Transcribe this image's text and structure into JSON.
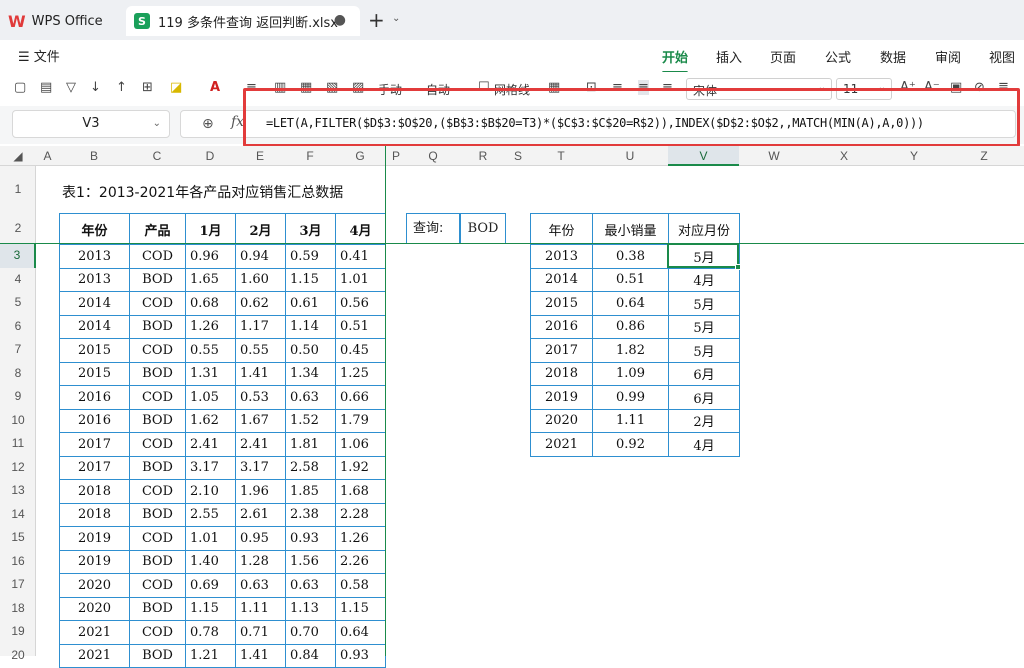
{
  "window": {
    "app_tab": "WPS Office",
    "file_tab": "119 多条件查询 返回判断.xlsx",
    "file_icon_letter": "S",
    "modified_dot": "●",
    "new_tab_glyph": "+",
    "new_tab_caret": "⌄"
  },
  "menubar": {
    "file_menu": "☰ 文件",
    "tabs": [
      "开始",
      "插入",
      "页面",
      "公式",
      "数据",
      "审阅",
      "视图"
    ],
    "active_tab": "开始"
  },
  "toolbar": {
    "manual": "手动",
    "auto": "自动",
    "gridlines": "网格线",
    "font_name": "宋体",
    "font_size": "11"
  },
  "formula_bar": {
    "name_box": "V3",
    "fx": "fx",
    "formula": "=LET(A,FILTER($D$3:$O$20,($B$3:$B$20=T3)*($C$3:$C$20=R$2)),INDEX($D$2:$O$2,,MATCH(MIN(A),A,0)))"
  },
  "columns": [
    "A",
    "B",
    "C",
    "D",
    "E",
    "F",
    "G",
    "P",
    "Q",
    "R",
    "S",
    "T",
    "U",
    "V",
    "W",
    "X",
    "Y",
    "Z"
  ],
  "selected_column": "V",
  "rows": [
    "1",
    "2",
    "3",
    "4",
    "5",
    "6",
    "7",
    "8",
    "9",
    "10",
    "11",
    "12",
    "13",
    "14",
    "15",
    "16",
    "17",
    "18",
    "19",
    "20"
  ],
  "selected_row": "3",
  "sheet": {
    "title": "表1：2013-2021年各产品对应销售汇总数据",
    "main_table": {
      "headers": [
        "年份",
        "产品",
        "1月",
        "2月",
        "3月",
        "4月"
      ],
      "rows": [
        [
          "2013",
          "COD",
          "0.96",
          "0.94",
          "0.59",
          "0.41"
        ],
        [
          "2013",
          "BOD",
          "1.65",
          "1.60",
          "1.15",
          "1.01"
        ],
        [
          "2014",
          "COD",
          "0.68",
          "0.62",
          "0.61",
          "0.56"
        ],
        [
          "2014",
          "BOD",
          "1.26",
          "1.17",
          "1.14",
          "0.51"
        ],
        [
          "2015",
          "COD",
          "0.55",
          "0.55",
          "0.50",
          "0.45"
        ],
        [
          "2015",
          "BOD",
          "1.31",
          "1.41",
          "1.34",
          "1.25"
        ],
        [
          "2016",
          "COD",
          "1.05",
          "0.53",
          "0.63",
          "0.66"
        ],
        [
          "2016",
          "BOD",
          "1.62",
          "1.67",
          "1.52",
          "1.79"
        ],
        [
          "2017",
          "COD",
          "2.41",
          "2.41",
          "1.81",
          "1.06"
        ],
        [
          "2017",
          "BOD",
          "3.17",
          "3.17",
          "2.58",
          "1.92"
        ],
        [
          "2018",
          "COD",
          "2.10",
          "1.96",
          "1.85",
          "1.68"
        ],
        [
          "2018",
          "BOD",
          "2.55",
          "2.61",
          "2.38",
          "2.28"
        ],
        [
          "2019",
          "COD",
          "1.01",
          "0.95",
          "0.93",
          "1.26"
        ],
        [
          "2019",
          "BOD",
          "1.40",
          "1.28",
          "1.56",
          "2.26"
        ],
        [
          "2020",
          "COD",
          "0.69",
          "0.63",
          "0.63",
          "0.58"
        ],
        [
          "2020",
          "BOD",
          "1.15",
          "1.11",
          "1.13",
          "1.15"
        ],
        [
          "2021",
          "COD",
          "0.78",
          "0.71",
          "0.70",
          "0.64"
        ],
        [
          "2021",
          "BOD",
          "1.21",
          "1.41",
          "0.84",
          "0.93"
        ]
      ]
    },
    "query": {
      "label": "查询:",
      "value": "BOD"
    },
    "result_table": {
      "headers": [
        "年份",
        "最小销量",
        "对应月份"
      ],
      "rows": [
        [
          "2013",
          "0.38",
          "5月"
        ],
        [
          "2014",
          "0.51",
          "4月"
        ],
        [
          "2015",
          "0.64",
          "5月"
        ],
        [
          "2016",
          "0.86",
          "5月"
        ],
        [
          "2017",
          "1.82",
          "5月"
        ],
        [
          "2018",
          "1.09",
          "6月"
        ],
        [
          "2019",
          "0.99",
          "6月"
        ],
        [
          "2020",
          "1.11",
          "2月"
        ],
        [
          "2021",
          "0.92",
          "4月"
        ]
      ]
    }
  },
  "colors": {
    "accent": "#1a8a4a",
    "table_border": "#2e8fd0",
    "highlight_box": "#e23b3b"
  }
}
